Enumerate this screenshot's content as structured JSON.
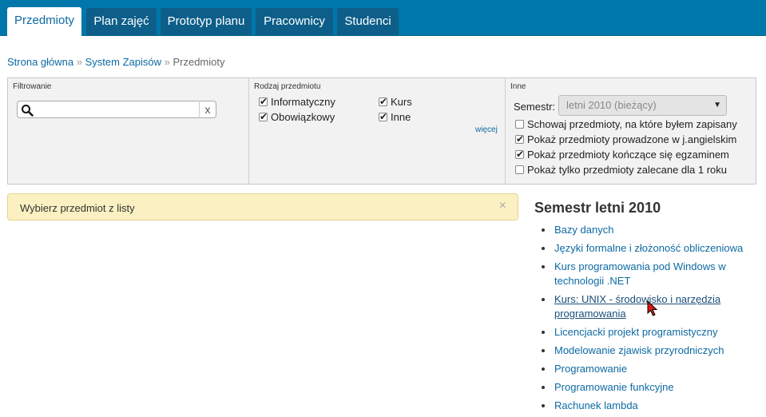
{
  "nav": {
    "tabs": [
      {
        "label": "Przedmioty",
        "active": true
      },
      {
        "label": "Plan zajęć",
        "active": false
      },
      {
        "label": "Prototyp planu",
        "active": false
      },
      {
        "label": "Pracownicy",
        "active": false
      },
      {
        "label": "Studenci",
        "active": false
      }
    ]
  },
  "breadcrumb": {
    "items": [
      "Strona główna",
      "System Zapisów",
      "Przedmioty"
    ],
    "separator": "»"
  },
  "filters": {
    "filter_title": "Filtrowanie",
    "search": {
      "value": "",
      "placeholder": "",
      "clear_label": "x"
    },
    "type_title": "Rodzaj przedmiotu",
    "types": [
      {
        "label": "Informatyczny",
        "checked": true
      },
      {
        "label": "Kurs",
        "checked": true
      },
      {
        "label": "Obowiązkowy",
        "checked": true
      },
      {
        "label": "Inne",
        "checked": true
      }
    ],
    "more_link": "więcej",
    "other_title": "Inne",
    "semester_label": "Semestr:",
    "semester_value": "letni 2010 (bieżący)",
    "options": [
      {
        "label": "Schowaj przedmioty, na które byłem zapisany",
        "checked": false
      },
      {
        "label": "Pokaż przedmioty prowadzone w j.angielskim",
        "checked": true
      },
      {
        "label": "Pokaż przedmioty kończące się egzaminem",
        "checked": true
      },
      {
        "label": "Pokaż tylko przedmioty zalecane dla 1 roku",
        "checked": false
      }
    ]
  },
  "alert": {
    "text": "Wybierz przedmiot z listy",
    "close": "×"
  },
  "semester_list": {
    "heading": "Semestr letni 2010",
    "courses": [
      "Bazy danych",
      "Języki formalne i złożoność obliczeniowa",
      "Kurs programowania pod Windows w technologii .NET",
      "Kurs: UNIX - środowisko i narzędzia programowania",
      "Licencjacki projekt programistyczny",
      "Modelowanie zjawisk przyrodniczych",
      "Programowanie",
      "Programowanie funkcyjne",
      "Rachunek lambda"
    ],
    "hovered_index": 3
  },
  "colors": {
    "nav_bg": "#0077aa",
    "tab_bg": "#0d5f8a",
    "link": "#0d6aa3",
    "alert_bg": "#fbf0c1"
  }
}
